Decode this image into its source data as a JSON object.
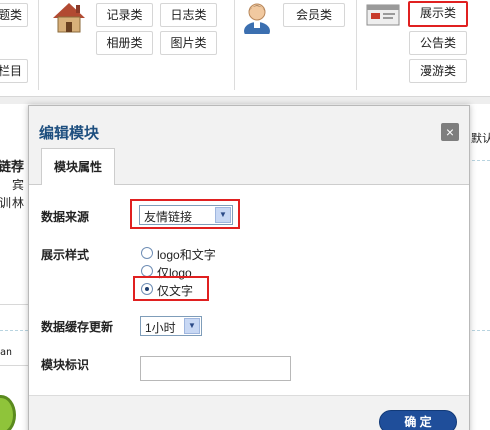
{
  "toolbar": {
    "left_group": [
      "题类",
      "栏目"
    ],
    "content_group": [
      "记录类",
      "日志类",
      "相册类",
      "图片类"
    ],
    "member_group": [
      "会员类"
    ],
    "display_group": [
      "展示类",
      "公告类",
      "漫游类"
    ],
    "highlighted": "展示类"
  },
  "background": {
    "right_text": "默认",
    "left_fragments": [
      "链荐",
      "宾",
      "训",
      "林",
      "an"
    ]
  },
  "modal": {
    "title": "编辑模块",
    "tab": "模块属性",
    "fields": {
      "data_source_label": "数据来源",
      "data_source_value": "友情链接",
      "display_style_label": "展示样式",
      "display_options": [
        "logo和文字",
        "仅logo",
        "仅文字"
      ],
      "selected_display_option": "仅文字",
      "cache_label": "数据缓存更新",
      "cache_value": "1小时",
      "module_id_label": "模块标识",
      "module_id_value": ""
    },
    "ok_button": "确 定",
    "close_symbol": "×"
  },
  "colors": {
    "accent_title": "#1e4f7f",
    "highlight_border": "#e02020",
    "ok_button": "#1f4e9a"
  },
  "icons": [
    "house-icon",
    "person-icon",
    "card-icon",
    "close-icon",
    "dropdown-arrow-icon"
  ]
}
